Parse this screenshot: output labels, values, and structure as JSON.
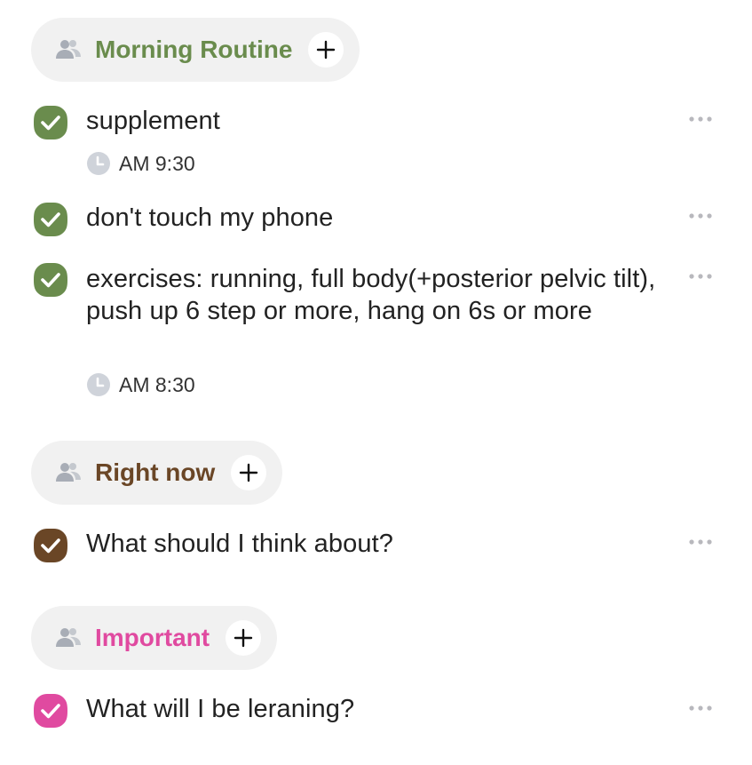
{
  "colors": {
    "group_green": "#6a8c4d",
    "group_brown": "#6a4626",
    "group_pink": "#e04aa0",
    "pill_bg": "#f1f1f1",
    "people_icon": "#a8adb6",
    "clock_icon": "#cfd3da",
    "more_dots": "#b8b8bd"
  },
  "icons": {
    "group_icon": "people-icon",
    "add_icon": "plus-icon",
    "check_icon": "checkmark-icon",
    "time_icon": "clock-icon",
    "more_icon": "more-dots-icon"
  },
  "groups": [
    {
      "title": "Morning Routine",
      "color": "#6a8c4d",
      "tasks": [
        {
          "text": "supplement",
          "time": "AM 9:30"
        },
        {
          "text": "don't touch my phone"
        },
        {
          "text": "exercises: running, full body(+posterior pelvic tilt), push up 6 step or more, hang on 6s or more",
          "time": "AM 8:30"
        }
      ]
    },
    {
      "title": "Right now",
      "color": "#6a4626",
      "tasks": [
        {
          "text": "What should I think about?"
        }
      ]
    },
    {
      "title": "Important",
      "color": "#e04aa0",
      "tasks": [
        {
          "text": "What will I be leraning?"
        }
      ]
    }
  ]
}
